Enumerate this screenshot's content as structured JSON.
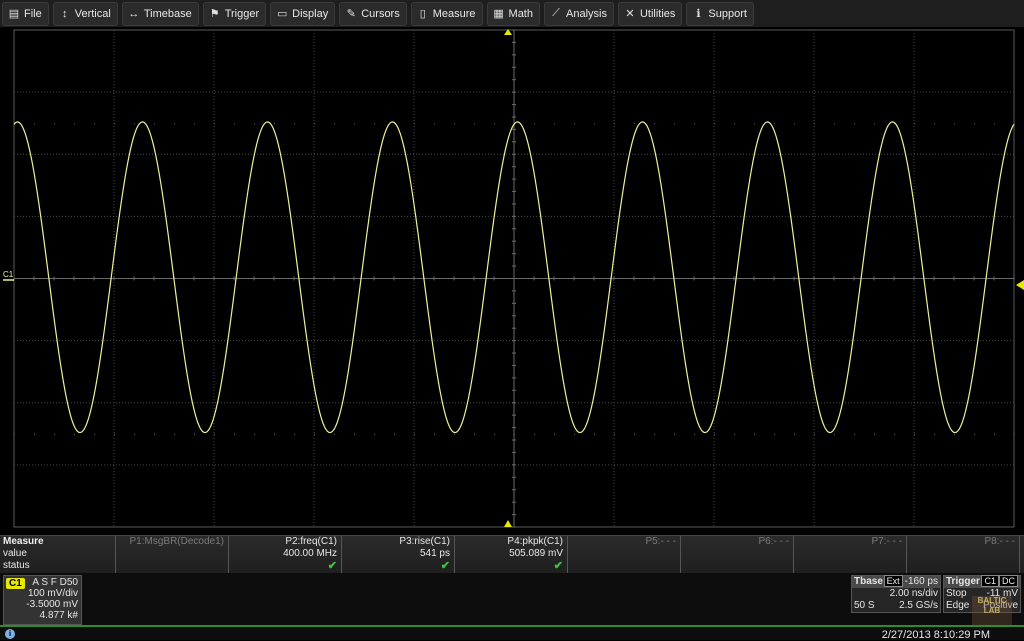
{
  "menubar": {
    "items": [
      {
        "label": "File",
        "icon": "file-icon",
        "glyph": "▤"
      },
      {
        "label": "Vertical",
        "icon": "vertical-arrows-icon",
        "glyph": "↕"
      },
      {
        "label": "Timebase",
        "icon": "horizontal-arrows-icon",
        "glyph": "↔"
      },
      {
        "label": "Trigger",
        "icon": "trigger-flag-icon",
        "glyph": "⚑"
      },
      {
        "label": "Display",
        "icon": "display-icon",
        "glyph": "▭"
      },
      {
        "label": "Cursors",
        "icon": "cursor-pen-icon",
        "glyph": "✎"
      },
      {
        "label": "Measure",
        "icon": "measure-icon",
        "glyph": "▯"
      },
      {
        "label": "Math",
        "icon": "calculator-icon",
        "glyph": "▦"
      },
      {
        "label": "Analysis",
        "icon": "analysis-chart-icon",
        "glyph": "⟋"
      },
      {
        "label": "Utilities",
        "icon": "tools-icon",
        "glyph": "✕"
      },
      {
        "label": "Support",
        "icon": "info-icon",
        "glyph": "ℹ"
      }
    ]
  },
  "screen": {
    "channel_marker": "C1",
    "trace_color": "#f0f09a",
    "waveform": {
      "frequency_mhz": 400,
      "cycles_on_screen": 8,
      "amplitude_divs": 2.5,
      "offset_divs": 0.02,
      "phase_deg": -100
    },
    "grid": {
      "h_divs": 10,
      "v_divs": 8
    },
    "trigger_level_color": "#e8e800"
  },
  "measure": {
    "title": "Measure",
    "row_labels": [
      "value",
      "status"
    ],
    "params": [
      {
        "name": "P1:MsgBR(Decode1)",
        "value": "",
        "status": "",
        "active": false
      },
      {
        "name": "P2:freq(C1)",
        "value": "400.00 MHz",
        "status": "✔",
        "active": true
      },
      {
        "name": "P3:rise(C1)",
        "value": "541 ps",
        "status": "✔",
        "active": true
      },
      {
        "name": "P4:pkpk(C1)",
        "value": "505.089 mV",
        "status": "✔",
        "active": true
      },
      {
        "name": "P5:- - -",
        "value": "",
        "status": "",
        "active": false
      },
      {
        "name": "P6:- - -",
        "value": "",
        "status": "",
        "active": false
      },
      {
        "name": "P7:- - -",
        "value": "",
        "status": "",
        "active": false
      },
      {
        "name": "P8:- - -",
        "value": "",
        "status": "",
        "active": false
      }
    ]
  },
  "channel1": {
    "tag": "C1",
    "flags": "A S F D50",
    "vdiv": "100 mV/div",
    "offset": "-3.5000 mV",
    "count": "4.877 k#"
  },
  "timebase": {
    "title": "Tbase",
    "badge": "Ext",
    "delay": "-160 ps",
    "tdiv": "2.00 ns/div",
    "samples": "50 S",
    "rate": "2.5 GS/s"
  },
  "trigger": {
    "title": "Trigger",
    "source": "C1",
    "coupling": "DC",
    "mode": "Stop",
    "level": "-11 mV",
    "type": "Edge",
    "slope": "Positive"
  },
  "watermark": {
    "line1": "BALTIC",
    "line2": "LAB"
  },
  "statusbar": {
    "datetime": "2/27/2013 8:10:29 PM"
  }
}
